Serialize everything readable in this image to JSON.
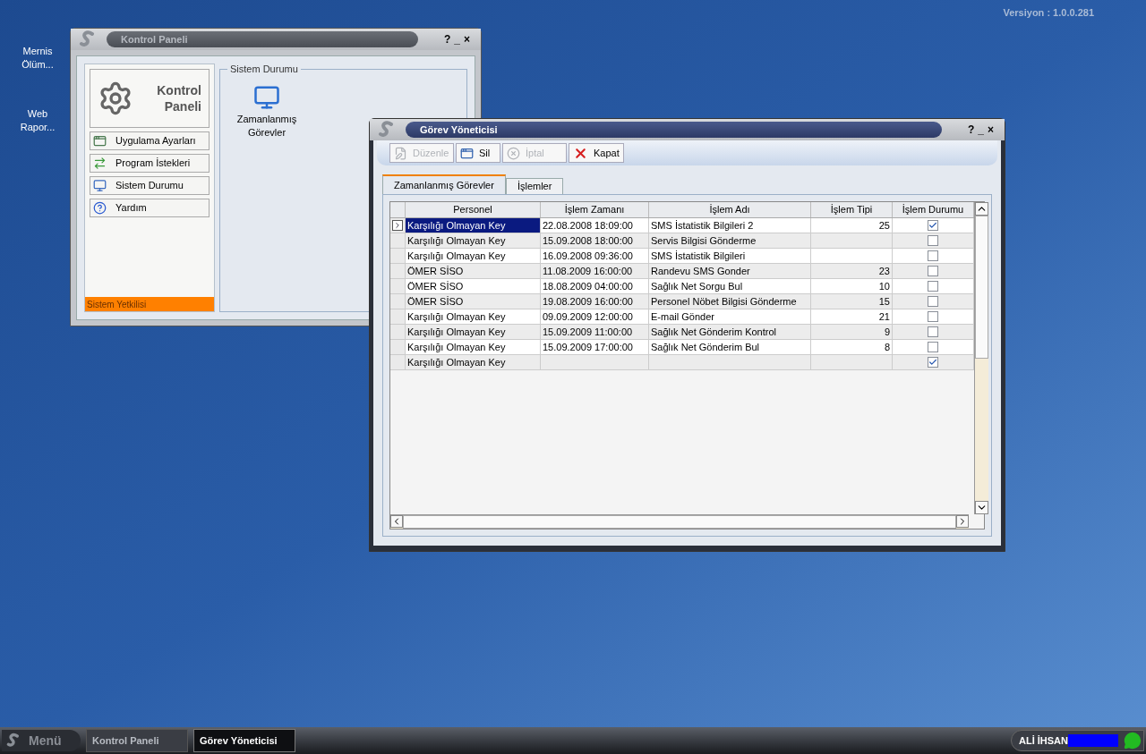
{
  "desktop": {
    "version": "Versiyon : 1.0.0.281",
    "icons": [
      {
        "label": "Mernis Ölüm..."
      },
      {
        "label": "Web Rapor..."
      }
    ]
  },
  "control_panel": {
    "title": "Kontrol Paneli",
    "controls": [
      "?",
      "_",
      "×"
    ],
    "logo_lines": [
      "Kontrol",
      "Paneli"
    ],
    "menu": [
      {
        "label": "Uygulama Ayarları",
        "kind": "settings"
      },
      {
        "label": "Program İstekleri",
        "kind": "requests"
      },
      {
        "label": "Sistem Durumu",
        "kind": "status"
      },
      {
        "label": "Yardım",
        "kind": "help"
      }
    ],
    "footer": "Sistem Yetkilisi",
    "group_title": "Sistem Durumu",
    "items": [
      {
        "label": "Zamanlanmış Görevler"
      }
    ]
  },
  "task_manager": {
    "title": "Görev Yöneticisi",
    "controls": [
      "?",
      "_",
      "×"
    ],
    "toolbar": [
      {
        "label": "Düzenle",
        "kind": "edit",
        "disabled": true
      },
      {
        "label": "Sil",
        "kind": "delete",
        "disabled": false
      },
      {
        "label": "İptal",
        "kind": "cancel",
        "disabled": true
      },
      {
        "label": "Kapat",
        "kind": "close",
        "disabled": false
      }
    ],
    "tabs": [
      {
        "label": "Zamanlanmış Görevler",
        "selected": true
      },
      {
        "label": "İşlemler",
        "selected": false
      }
    ],
    "table": {
      "columns": [
        "Personel",
        "İşlem Zamanı",
        "İşlem Adı",
        "İşlem Tipi",
        "İşlem Durumu"
      ],
      "rows": [
        {
          "personel": "Karşılığı Olmayan Key",
          "time": "22.08.2008 18:09:00",
          "name": "SMS İstatistik Bilgileri 2",
          "type": "25",
          "checked": true,
          "selected": true
        },
        {
          "personel": "Karşılığı Olmayan Key",
          "time": "15.09.2008 18:00:00",
          "name": "Servis Bilgisi Gönderme",
          "type": "",
          "checked": false,
          "selected": false
        },
        {
          "personel": "Karşılığı Olmayan Key",
          "time": "16.09.2008 09:36:00",
          "name": "SMS İstatistik Bilgileri",
          "type": "",
          "checked": false,
          "selected": false
        },
        {
          "personel": "ÖMER SİSO",
          "time": "11.08.2009 16:00:00",
          "name": "Randevu SMS Gonder",
          "type": "23",
          "checked": false,
          "selected": false
        },
        {
          "personel": "ÖMER SİSO",
          "time": "18.08.2009 04:00:00",
          "name": "Sağlık Net Sorgu Bul",
          "type": "10",
          "checked": false,
          "selected": false
        },
        {
          "personel": "ÖMER SİSO",
          "time": "19.08.2009 16:00:00",
          "name": "Personel Nöbet Bilgisi Gönderme",
          "type": "15",
          "checked": false,
          "selected": false
        },
        {
          "personel": "Karşılığı Olmayan Key",
          "time": "09.09.2009 12:00:00",
          "name": "E-mail Gönder",
          "type": "21",
          "checked": false,
          "selected": false
        },
        {
          "personel": "Karşılığı Olmayan Key",
          "time": "15.09.2009 11:00:00",
          "name": "Sağlık Net Gönderim Kontrol",
          "type": "9",
          "checked": false,
          "selected": false
        },
        {
          "personel": "Karşılığı Olmayan Key",
          "time": "15.09.2009 17:00:00",
          "name": "Sağlık Net Gönderim Bul",
          "type": "8",
          "checked": false,
          "selected": false
        },
        {
          "personel": "Karşılığı Olmayan Key",
          "time": "",
          "name": "",
          "type": "",
          "checked": true,
          "selected": false
        }
      ]
    }
  },
  "taskbar": {
    "menu_label": "Menü",
    "tasks": [
      {
        "label": "Kontrol Paneli",
        "selected": false
      },
      {
        "label": "Görev Yöneticisi",
        "selected": true
      }
    ],
    "user": "ALİ İHSAN"
  }
}
